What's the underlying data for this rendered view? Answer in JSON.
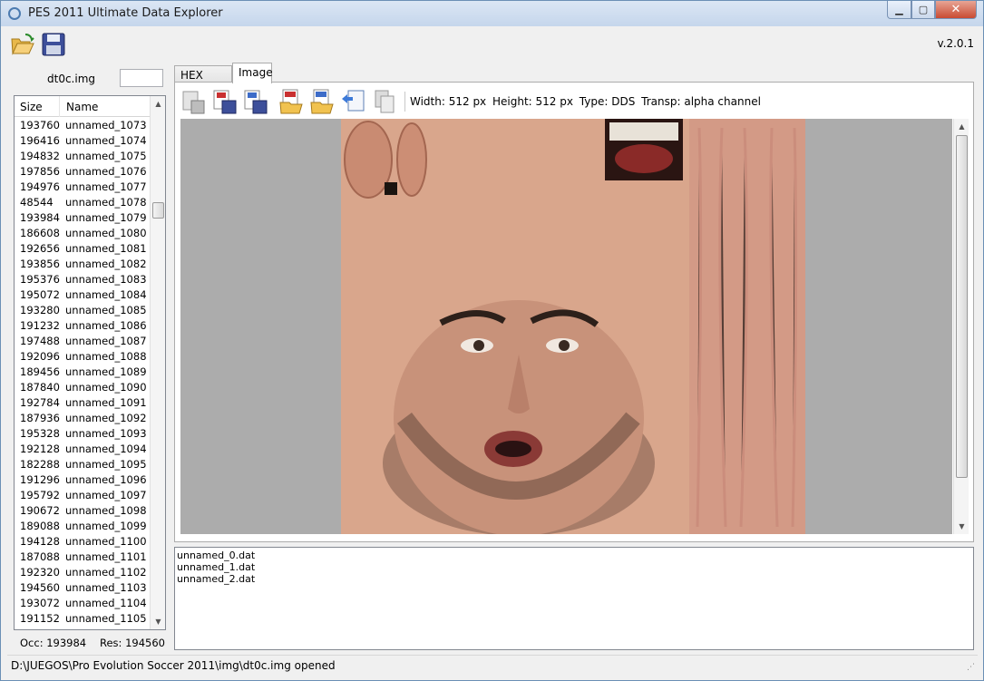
{
  "window": {
    "title": "PES 2011 Ultimate Data Explorer",
    "controls": {
      "minimize": "▁",
      "maximize": "▢",
      "close": "✕"
    }
  },
  "toolbar": {
    "open_icon": "folder-open-icon",
    "save_icon": "floppy-disk-icon",
    "version": "v.2.0.1"
  },
  "left_panel": {
    "file_label": "dt0c.img",
    "file_input_value": "",
    "columns": {
      "size": "Size",
      "name": "Name"
    },
    "rows": [
      {
        "size": "193760",
        "name": "unnamed_1073"
      },
      {
        "size": "196416",
        "name": "unnamed_1074"
      },
      {
        "size": "194832",
        "name": "unnamed_1075"
      },
      {
        "size": "197856",
        "name": "unnamed_1076"
      },
      {
        "size": "194976",
        "name": "unnamed_1077"
      },
      {
        "size": "48544",
        "name": "unnamed_1078"
      },
      {
        "size": "193984",
        "name": "unnamed_1079"
      },
      {
        "size": "186608",
        "name": "unnamed_1080"
      },
      {
        "size": "192656",
        "name": "unnamed_1081"
      },
      {
        "size": "193856",
        "name": "unnamed_1082"
      },
      {
        "size": "195376",
        "name": "unnamed_1083"
      },
      {
        "size": "195072",
        "name": "unnamed_1084"
      },
      {
        "size": "193280",
        "name": "unnamed_1085"
      },
      {
        "size": "191232",
        "name": "unnamed_1086"
      },
      {
        "size": "197488",
        "name": "unnamed_1087"
      },
      {
        "size": "192096",
        "name": "unnamed_1088"
      },
      {
        "size": "189456",
        "name": "unnamed_1089"
      },
      {
        "size": "187840",
        "name": "unnamed_1090"
      },
      {
        "size": "192784",
        "name": "unnamed_1091"
      },
      {
        "size": "187936",
        "name": "unnamed_1092"
      },
      {
        "size": "195328",
        "name": "unnamed_1093"
      },
      {
        "size": "192128",
        "name": "unnamed_1094"
      },
      {
        "size": "182288",
        "name": "unnamed_1095"
      },
      {
        "size": "191296",
        "name": "unnamed_1096"
      },
      {
        "size": "195792",
        "name": "unnamed_1097"
      },
      {
        "size": "190672",
        "name": "unnamed_1098"
      },
      {
        "size": "189088",
        "name": "unnamed_1099"
      },
      {
        "size": "194128",
        "name": "unnamed_1100"
      },
      {
        "size": "187088",
        "name": "unnamed_1101"
      },
      {
        "size": "192320",
        "name": "unnamed_1102"
      },
      {
        "size": "194560",
        "name": "unnamed_1103"
      },
      {
        "size": "193072",
        "name": "unnamed_1104"
      },
      {
        "size": "191152",
        "name": "unnamed_1105"
      }
    ],
    "scroll": {
      "up": "▲",
      "down": "▼"
    },
    "occ": "Occ: 193984",
    "res": "Res: 194560"
  },
  "tabs": [
    {
      "label": "HEX Editor",
      "active": false
    },
    {
      "label": "Image",
      "active": true
    }
  ],
  "image_toolbar": {
    "buttons": [
      {
        "icon": "save-all-icon"
      },
      {
        "icon": "export-24bit-icon"
      },
      {
        "icon": "export-dds-icon"
      },
      {
        "icon": "import-png-icon"
      },
      {
        "icon": "import-dds-icon"
      },
      {
        "icon": "copy-image-icon"
      },
      {
        "icon": "paste-image-icon"
      }
    ],
    "width": "Width: 512 px",
    "height": "Height: 512 px",
    "type": "Type: DDS",
    "transp": "Transp: alpha channel"
  },
  "log_lines": [
    "unnamed_0.dat",
    "unnamed_1.dat",
    "unnamed_2.dat"
  ],
  "status": "D:\\JUEGOS\\Pro Evolution Soccer 2011\\img\\dt0c.img opened",
  "colors": {
    "title_bar": "#c5d6ec",
    "close_button": "#c94b32",
    "image_background": "#acacac",
    "skin": "#d8a890"
  }
}
